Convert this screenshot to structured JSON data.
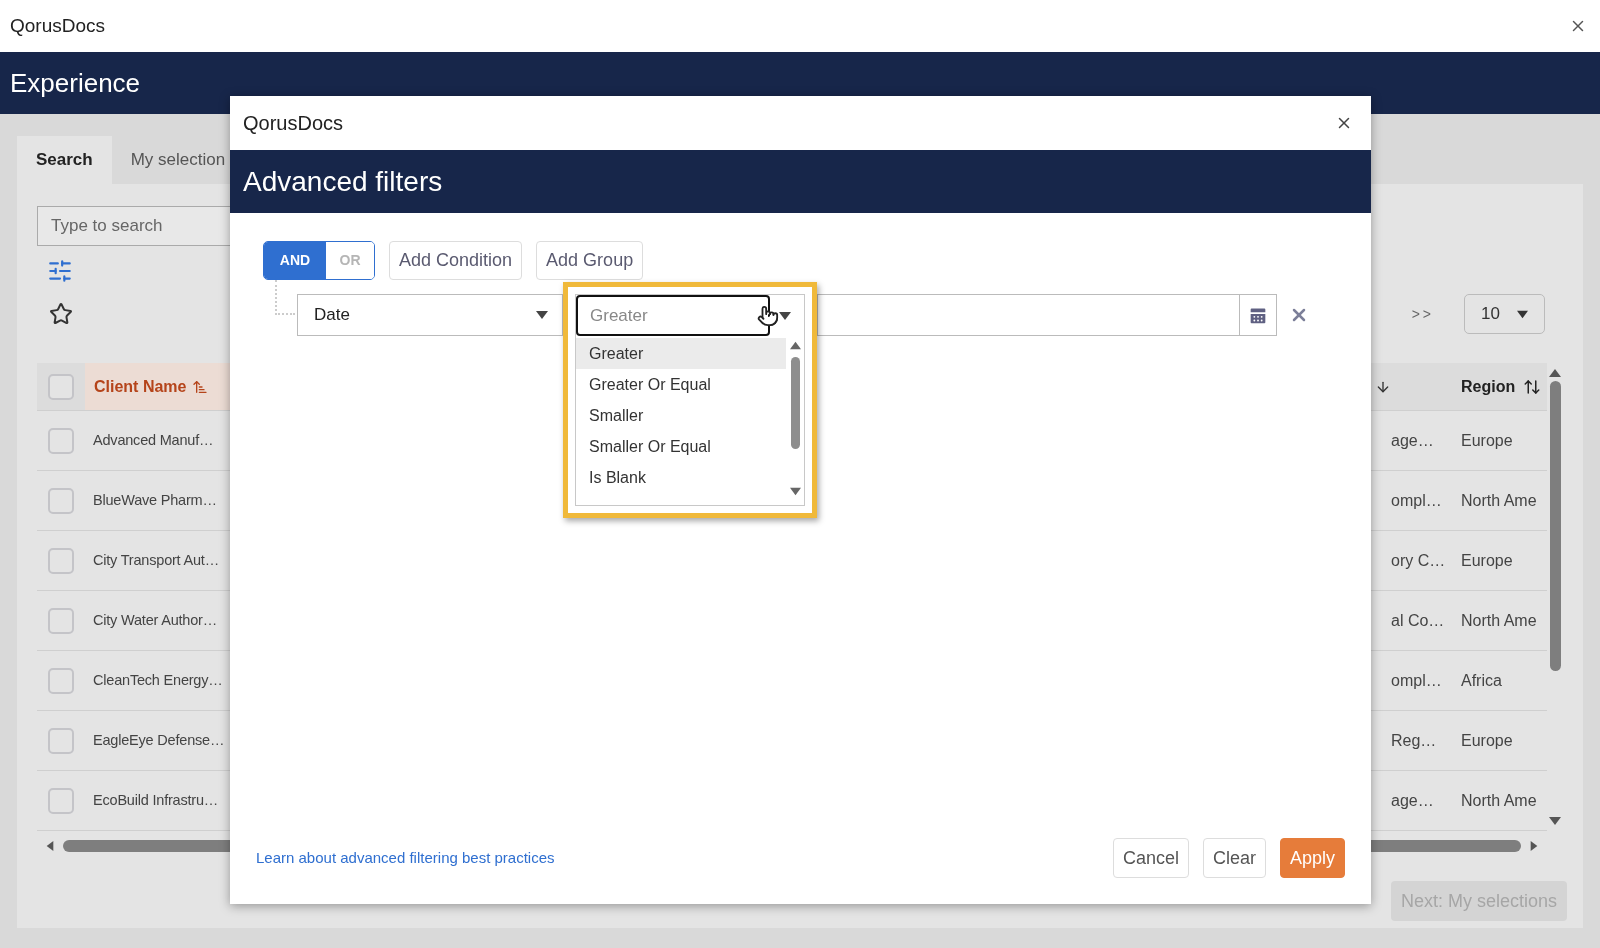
{
  "app_bar": {
    "title": "QorusDocs"
  },
  "header": {
    "title": "Experience"
  },
  "tabs": [
    {
      "label": "Search",
      "selected": true
    },
    {
      "label": "My selection",
      "selected": false
    }
  ],
  "search": {
    "placeholder": "Type to search"
  },
  "pagination": {
    "next": ">>",
    "page_size": "10"
  },
  "table": {
    "header_checked": false,
    "columns": [
      {
        "label": "Client Name",
        "sorted": true
      },
      {
        "label": "Region",
        "sorted": false
      }
    ],
    "rows": [
      {
        "client": "Advanced Manuf…",
        "column_2": "age…",
        "region": "Europe",
        "checked": false
      },
      {
        "client": "BlueWave Pharm…",
        "column_2": "ompl…",
        "region": "North Ame",
        "checked": false
      },
      {
        "client": "City Transport Aut…",
        "column_2": "ory C…",
        "region": "Europe",
        "checked": false
      },
      {
        "client": "City Water Author…",
        "column_2": "al Co…",
        "region": "North Ame",
        "checked": false
      },
      {
        "client": "CleanTech Energy…",
        "column_2": "ompl…",
        "region": "Africa",
        "checked": false
      },
      {
        "client": "EagleEye Defense…",
        "column_2": "Reg…",
        "region": "Europe",
        "checked": false
      },
      {
        "client": "EcoBuild Infrastru…",
        "column_2": "age…",
        "region": "North Ame",
        "checked": false
      }
    ]
  },
  "next_button": {
    "label": "Next: My selections",
    "disabled": true
  },
  "dialog": {
    "title": "QorusDocs",
    "heading": "Advanced filters",
    "logic": [
      {
        "label": "AND",
        "selected": true
      },
      {
        "label": "OR",
        "selected": false
      }
    ],
    "actions": [
      "Add Condition",
      "Add Group"
    ],
    "condition": {
      "field": "Date",
      "operator_placeholder": "Greater",
      "options": [
        {
          "label": "Greater",
          "selected": true
        },
        {
          "label": "Greater Or Equal",
          "selected": false
        },
        {
          "label": "Smaller",
          "selected": false
        },
        {
          "label": "Smaller Or Equal",
          "selected": false
        },
        {
          "label": "Is Blank",
          "selected": false
        }
      ]
    },
    "link": "Learn about advanced filtering best practices",
    "buttons": [
      {
        "label": "Cancel",
        "kind": "secondary"
      },
      {
        "label": "Clear",
        "kind": "secondary"
      },
      {
        "label": "Apply",
        "kind": "primary"
      }
    ]
  }
}
